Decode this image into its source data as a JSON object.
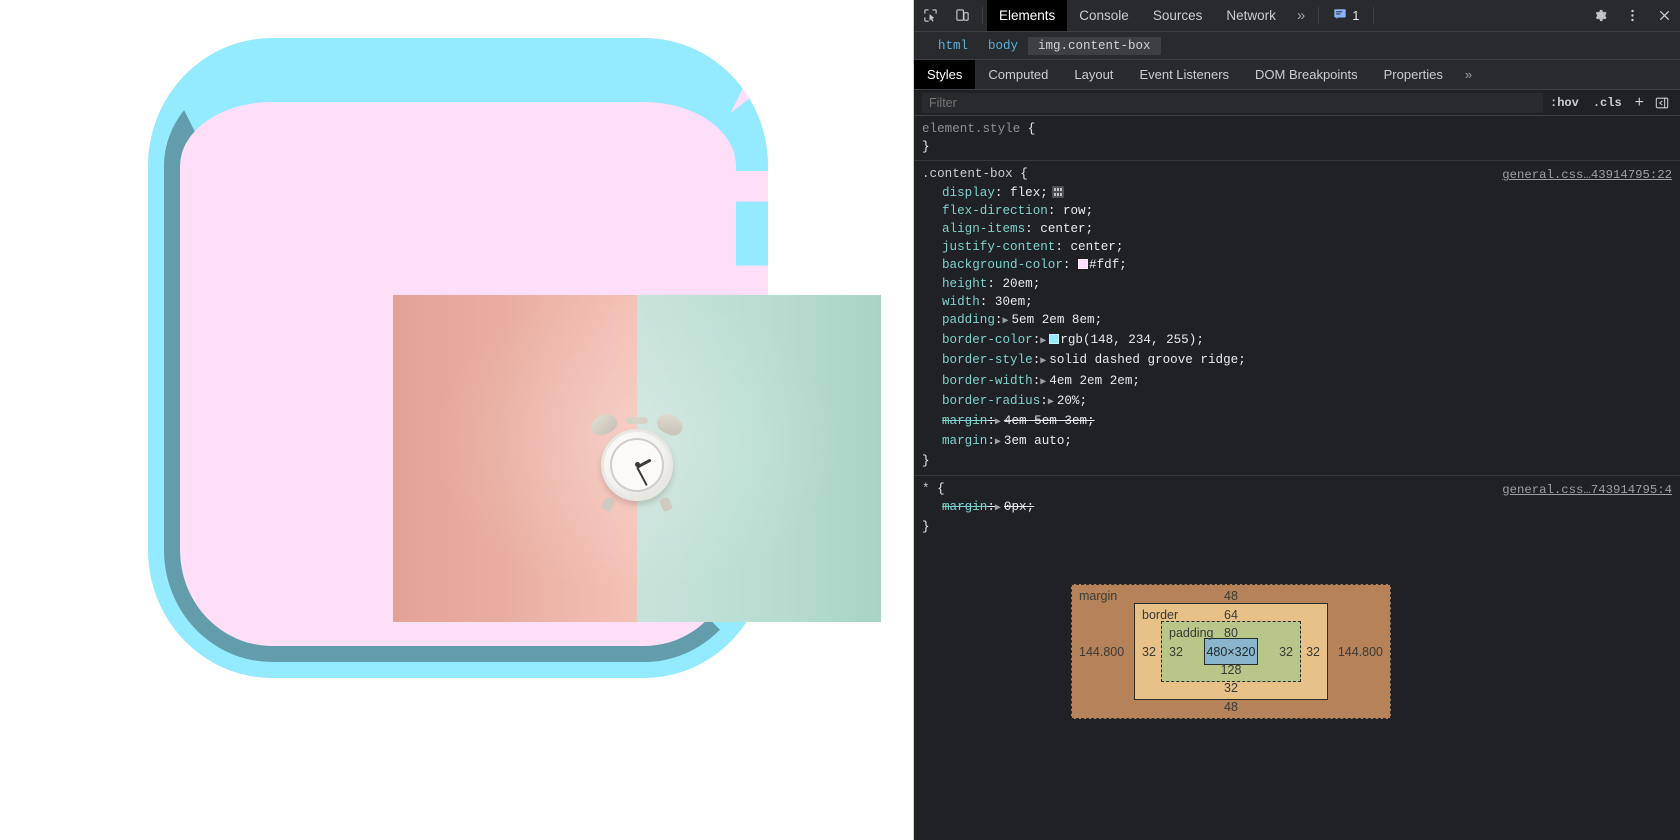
{
  "page": {
    "element_class": "content-box",
    "photo_alt": "alarm-clock-photo",
    "content_size": "480×320"
  },
  "devtools": {
    "toolbar": {
      "inspect_icon": "inspect-element-icon",
      "device_icon": "device-toolbar-icon",
      "tabs": [
        {
          "label": "Elements",
          "active": true
        },
        {
          "label": "Console",
          "active": false
        },
        {
          "label": "Sources",
          "active": false
        },
        {
          "label": "Network",
          "active": false
        }
      ],
      "more_tabs": "»",
      "message_icon": "message-icon",
      "message_count": "1",
      "settings_icon": "gear-icon",
      "kebab_icon": "more-options-icon",
      "close_icon": "close-icon"
    },
    "breadcrumb": [
      {
        "label": "html",
        "active": false
      },
      {
        "label": "body",
        "active": false
      },
      {
        "label": "img.content-box",
        "active": true
      }
    ],
    "sidebar_tabs": [
      {
        "label": "Styles",
        "active": true
      },
      {
        "label": "Computed",
        "active": false
      },
      {
        "label": "Layout",
        "active": false
      },
      {
        "label": "Event Listeners",
        "active": false
      },
      {
        "label": "DOM Breakpoints",
        "active": false
      },
      {
        "label": "Properties",
        "active": false
      }
    ],
    "sidebar_tabs_more": "»",
    "filter": {
      "placeholder": "Filter",
      "value": "",
      "hov_label": ":hov",
      "cls_label": ".cls",
      "new_rule_label": "+",
      "toggle_panel_icon": "toggle-sidebar-icon"
    },
    "rules": [
      {
        "selector": "element.style",
        "source": "",
        "declarations": []
      },
      {
        "selector": ".content-box",
        "source": "general.css…43914795:22",
        "declarations": [
          {
            "property": "display",
            "value": "flex",
            "expandable": false,
            "overridden": false,
            "badge": "flex-badge"
          },
          {
            "property": "flex-direction",
            "value": "row",
            "expandable": false,
            "overridden": false
          },
          {
            "property": "align-items",
            "value": "center",
            "expandable": false,
            "overridden": false
          },
          {
            "property": "justify-content",
            "value": "center",
            "expandable": false,
            "overridden": false
          },
          {
            "property": "background-color",
            "value": "#fdf",
            "expandable": false,
            "overridden": false,
            "swatch": "#ffddff"
          },
          {
            "property": "height",
            "value": "20em",
            "expandable": false,
            "overridden": false
          },
          {
            "property": "width",
            "value": "30em",
            "expandable": false,
            "overridden": false
          },
          {
            "property": "padding",
            "value": "5em 2em 8em",
            "expandable": true,
            "overridden": false
          },
          {
            "property": "border-color",
            "value": "rgb(148, 234, 255)",
            "expandable": true,
            "overridden": false,
            "swatch": "#94eaff"
          },
          {
            "property": "border-style",
            "value": "solid dashed groove ridge",
            "expandable": true,
            "overridden": false
          },
          {
            "property": "border-width",
            "value": "4em 2em 2em",
            "expandable": true,
            "overridden": false
          },
          {
            "property": "border-radius",
            "value": "20%",
            "expandable": true,
            "overridden": false
          },
          {
            "property": "margin",
            "value": "4em 5em 3em",
            "expandable": true,
            "overridden": true
          },
          {
            "property": "margin",
            "value": "3em auto",
            "expandable": true,
            "overridden": false
          }
        ]
      },
      {
        "selector": "*",
        "source": "general.css…743914795:4",
        "declarations": [
          {
            "property": "margin",
            "value": "0px",
            "expandable": true,
            "overridden": true
          }
        ]
      }
    ],
    "box_model": {
      "margin": {
        "label": "margin",
        "top": "48",
        "right": "144.800",
        "bottom": "48",
        "left": "144.800"
      },
      "border": {
        "label": "border",
        "top": "64",
        "right": "32",
        "bottom": "32",
        "left": "32"
      },
      "padding": {
        "label": "padding",
        "top": "80",
        "right": "32",
        "bottom": "128",
        "left": "32"
      },
      "content": {
        "size": "480×320"
      }
    }
  },
  "colors": {
    "accent_blue": "#8ab4f8",
    "border_cyan": "#94eaff",
    "bg_pink": "#ffddff",
    "devtools_bg": "#202124",
    "devtools_panel": "#292a2d"
  }
}
